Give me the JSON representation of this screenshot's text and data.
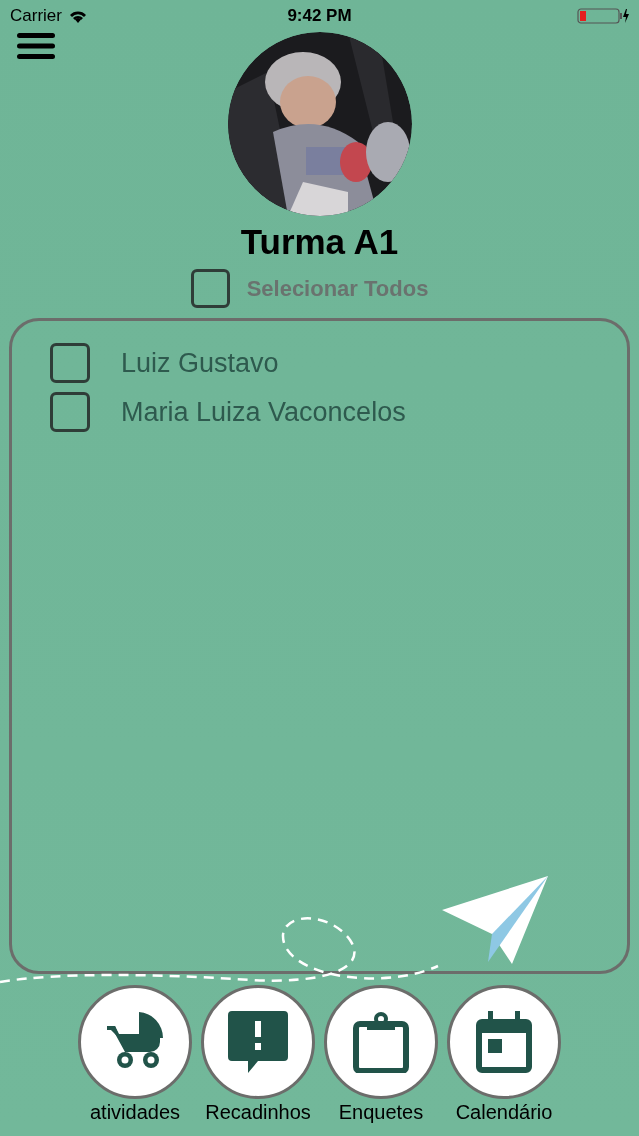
{
  "status_bar": {
    "carrier": "Carrier",
    "time": "9:42 PM"
  },
  "title": "Turma A1",
  "select_all": {
    "label": "Selecionar Todos",
    "checked": false
  },
  "students": [
    {
      "name": "Luiz Gustavo",
      "checked": false
    },
    {
      "name": "Maria Luiza Vaconcelos",
      "checked": false
    }
  ],
  "nav": [
    {
      "kind": "stroller",
      "label": "atividades"
    },
    {
      "kind": "message",
      "label": "Recadinhos"
    },
    {
      "kind": "clipboard",
      "label": "Enquetes"
    },
    {
      "kind": "calendar",
      "label": "Calendário"
    }
  ]
}
